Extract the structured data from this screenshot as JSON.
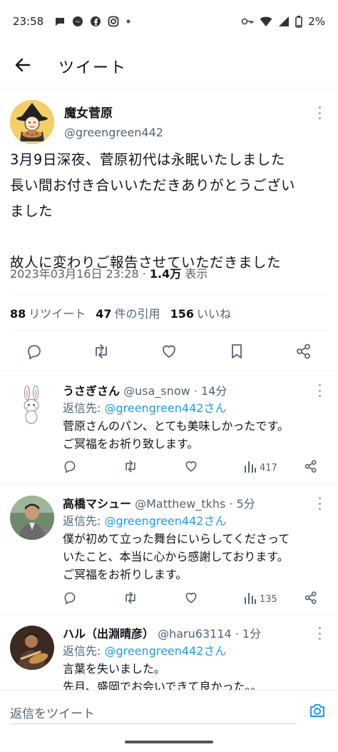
{
  "status_bar": {
    "time": "23:58",
    "battery": "2%",
    "icons": [
      "chat-bubble-icon",
      "messenger-icon",
      "facebook-icon",
      "instagram-icon",
      "dot-icon",
      "key-icon",
      "wifi-icon",
      "signal-icon",
      "battery-icon"
    ]
  },
  "header": {
    "title": "ツイート",
    "back_icon": "arrow-left-icon"
  },
  "main_tweet": {
    "author_name": "魔女菅原",
    "author_handle": "@greengreen442",
    "lines": [
      "3月9日深夜、菅原初代は永眠いたしました",
      "長い間お付き合いいただきありがとうござい",
      "ました",
      "",
      "故人に変わりご報告させていただきました"
    ],
    "timestamp": "2023年03月16日 23:28 · ",
    "views_count": "1.4万",
    "views_label": " 表示",
    "retweets_count": "88",
    "retweets_label": "リツイート",
    "quotes_count": "47",
    "quotes_label": "件の引用",
    "likes_count": "156",
    "likes_label": "いいね"
  },
  "replies": [
    {
      "name": "うさぎさん",
      "handle": "@usa_snow",
      "time": " · 14分",
      "reply_to_label": "返信先: ",
      "reply_to_handle": "@greengreen442さん",
      "lines": [
        "菅原さんのパン、とても美味しかったです。",
        "ご冥福をお祈り致します。"
      ],
      "views": "417"
    },
    {
      "name": "高橋マシュー",
      "handle": "@Matthew_tkhs",
      "time": " · 5分",
      "reply_to_label": "返信先: ",
      "reply_to_handle": "@greengreen442さん",
      "lines": [
        "僕が初めて立った舞台にいらしてくださって",
        "いたこと、本当に心から感謝しております。",
        "ご冥福をお祈りします。"
      ],
      "views": "135"
    },
    {
      "name": "ハル（出淵晴彦）",
      "handle": "@haru63114",
      "time": " · 1分",
      "reply_to_label": "返信先: ",
      "reply_to_handle": "@greengreen442さん",
      "lines": [
        "言葉を失いました。",
        "先月、盛岡でお会いできて良かった。。"
      ],
      "views": ""
    }
  ],
  "compose": {
    "placeholder": "返信をツイート"
  },
  "colors": {
    "accent": "#1d9bf0",
    "secondary_text": "#536471",
    "primary_text": "#0f1419"
  }
}
